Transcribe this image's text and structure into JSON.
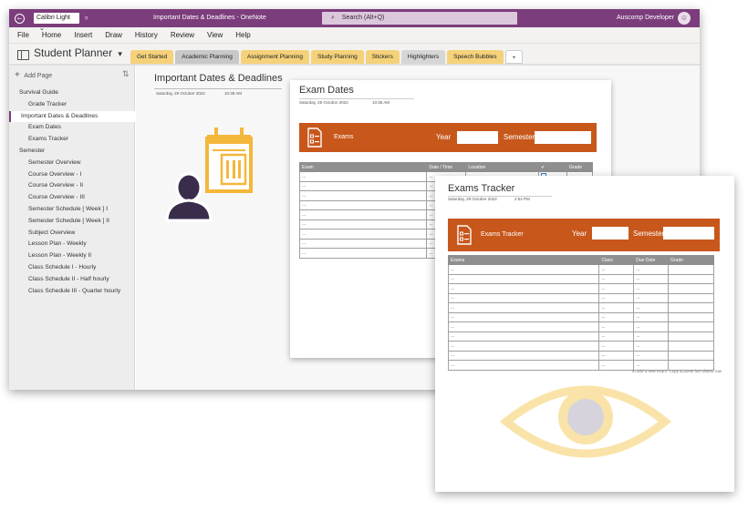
{
  "titlebar": {
    "back_glyph": "⭠",
    "font_name": "Calibri Light",
    "font_chevron": "⌄",
    "qa_glyph": "▿",
    "title": "Important Dates & Deadlines  -  OneNote",
    "search_icon": "⌕",
    "search_placeholder": "Search (Alt+Q)",
    "user": "Auscomp Developer",
    "avatar_glyph": "☺"
  },
  "menu": [
    "File",
    "Home",
    "Insert",
    "Draw",
    "History",
    "Review",
    "View",
    "Help"
  ],
  "notebook": {
    "title": "Student Planner",
    "chevron": "▾",
    "tabs": [
      {
        "label": "Get Started",
        "color": "#f5d27a"
      },
      {
        "label": "Academic Planning",
        "color": "#c8c8c8",
        "selected": true
      },
      {
        "label": "Assignment Planning",
        "color": "#f5d27a"
      },
      {
        "label": "Study Planning",
        "color": "#f5d27a"
      },
      {
        "label": "Stickers",
        "color": "#f5d27a"
      },
      {
        "label": "Highlighters",
        "color": "#d6d6d6"
      },
      {
        "label": "Speech Bubbles",
        "color": "#f5d27a"
      },
      {
        "label": "+",
        "color": "#ffffff"
      }
    ]
  },
  "sidebar": {
    "add_page": "Add Page",
    "add_glyph": "+",
    "sort_glyph": "⇅",
    "pages": [
      {
        "label": "Survival Guide",
        "level": 0
      },
      {
        "label": "Grade Tracker",
        "level": 1
      },
      {
        "label": "Important Dates & Deadlines",
        "level": 0,
        "selected": true
      },
      {
        "label": "Exam Dates",
        "level": 1
      },
      {
        "label": "Exams Tracker",
        "level": 1
      },
      {
        "label": "Semester",
        "level": 0
      },
      {
        "label": "Semester Overview",
        "level": 1
      },
      {
        "label": "Course Overview - I",
        "level": 1
      },
      {
        "label": "Course Overview - II",
        "level": 1
      },
      {
        "label": "Course Overview - III",
        "level": 1
      },
      {
        "label": "Semester Schedule [ Week ] I",
        "level": 1
      },
      {
        "label": "Semester Schedule [ Week ] II",
        "level": 1
      },
      {
        "label": "Subject Overview",
        "level": 1
      },
      {
        "label": "Lesson Plan - Weekly",
        "level": 1
      },
      {
        "label": "Lesson Plan - Weekly II",
        "level": 1
      },
      {
        "label": "Class Schedule I - Hourly",
        "level": 1
      },
      {
        "label": "Class Schedule II - Half hourly",
        "level": 1
      },
      {
        "label": "Class Schedule III - Quarter hourly",
        "level": 1
      }
    ]
  },
  "page": {
    "title": "Important Dates & Deadlines",
    "date": "Saturday, 29 October 2022",
    "time": "10:38 AM"
  },
  "exam_dates": {
    "title": "Exam Dates",
    "date": "Saturday, 29 October 2022",
    "time": "10:35 AM",
    "banner_label": "Exams",
    "year_label": "Year",
    "semester_label": "Semester",
    "columns": [
      "Exam",
      "Date / Time",
      "Location",
      "✔",
      "Grade"
    ],
    "rows": [
      [
        "...",
        "...",
        "...",
        "",
        ""
      ],
      [
        "...",
        "...",
        "",
        "",
        ""
      ],
      [
        "...",
        "...",
        "",
        "",
        ""
      ],
      [
        "...",
        "...",
        "",
        "",
        ""
      ],
      [
        "...",
        "...",
        "",
        "",
        ""
      ],
      [
        "...",
        "...",
        "",
        "",
        ""
      ],
      [
        "...",
        "...",
        "",
        "",
        ""
      ],
      [
        "...",
        "...",
        "",
        "",
        ""
      ],
      [
        "...",
        "...",
        "",
        "",
        ""
      ]
    ]
  },
  "exams_tracker": {
    "title": "Exams Tracker",
    "date": "Saturday, 29 October 2022",
    "time": "2:54 PM",
    "banner_label": "Exams Tracker",
    "year_label": "Year",
    "semester_label": "Semester",
    "columns": [
      "Exams",
      "Class",
      "Due Date",
      "Grade"
    ],
    "rows": [
      [
        "...",
        "...",
        "...",
        ""
      ],
      [
        "...",
        "...",
        "...",
        ""
      ],
      [
        "...",
        "...",
        "...",
        ""
      ],
      [
        "...",
        "...",
        "...",
        ""
      ],
      [
        "...",
        "...",
        "...",
        ""
      ],
      [
        "...",
        "...",
        "...",
        ""
      ],
      [
        "...",
        "...",
        "...",
        ""
      ],
      [
        "...",
        "...",
        "...",
        ""
      ],
      [
        "...",
        "...",
        "...",
        ""
      ],
      [
        "...",
        "...",
        "...",
        ""
      ],
      [
        "...",
        "...",
        "...",
        ""
      ]
    ],
    "hint": "To add a new exam: Copy & paste last dotted row"
  },
  "colors": {
    "onenote_purple": "#7c3d7c",
    "banner_orange": "#c8571b",
    "header_gray": "#8f8f8f",
    "watermark_yellow": "#f7d98a"
  }
}
